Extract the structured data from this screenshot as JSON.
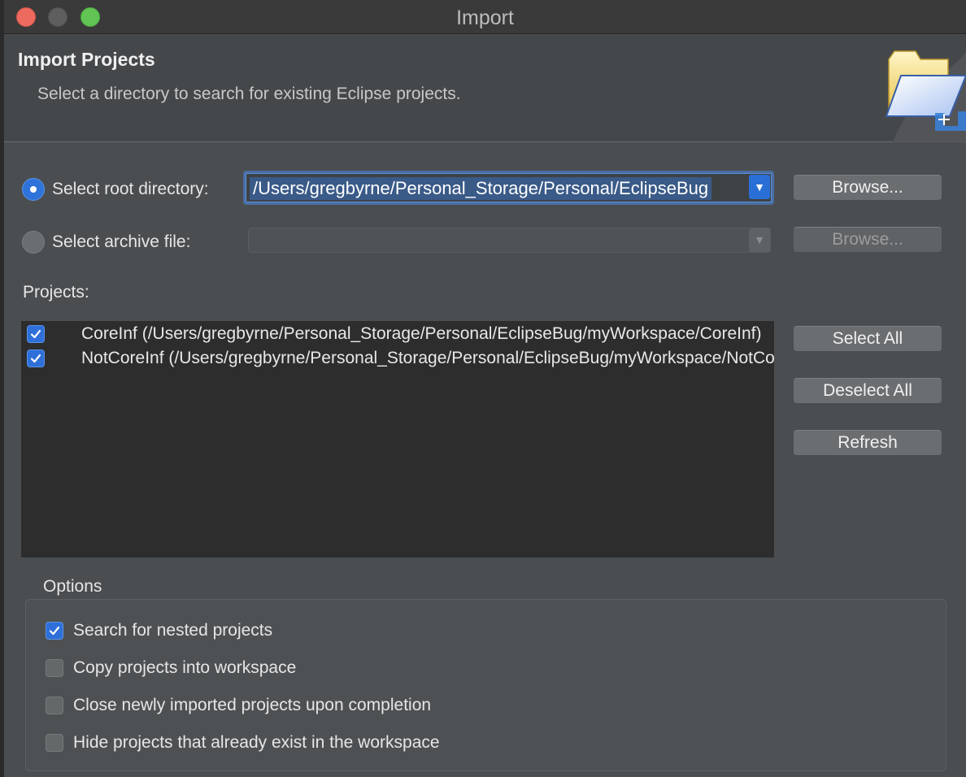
{
  "window": {
    "title": "Import"
  },
  "header": {
    "title": "Import Projects",
    "description": "Select a directory to search for existing Eclipse projects."
  },
  "source": {
    "root_directory": {
      "label": "Select root directory:",
      "selected": true,
      "value": "/Users/gregbyrne/Personal_Storage/Personal/EclipseBug",
      "browse_label": "Browse..."
    },
    "archive_file": {
      "label": "Select archive file:",
      "selected": false,
      "value": "",
      "browse_label": "Browse..."
    }
  },
  "projects": {
    "label": "Projects:",
    "items": [
      {
        "checked": true,
        "text": "CoreInf (/Users/gregbyrne/Personal_Storage/Personal/EclipseBug/myWorkspace/CoreInf)"
      },
      {
        "checked": true,
        "text": "NotCoreInf (/Users/gregbyrne/Personal_Storage/Personal/EclipseBug/myWorkspace/NotCoreInf)"
      }
    ],
    "buttons": {
      "select_all": "Select All",
      "deselect_all": "Deselect All",
      "refresh": "Refresh"
    }
  },
  "options": {
    "title": "Options",
    "items": [
      {
        "checked": true,
        "label": "Search for nested projects"
      },
      {
        "checked": false,
        "label": "Copy projects into workspace"
      },
      {
        "checked": false,
        "label": "Close newly imported projects upon completion"
      },
      {
        "checked": false,
        "label": "Hide projects that already exist in the workspace"
      }
    ]
  },
  "colors": {
    "accent": "#2e6fd9",
    "background": "#4b4e50",
    "list_background": "#2d2d2d"
  }
}
